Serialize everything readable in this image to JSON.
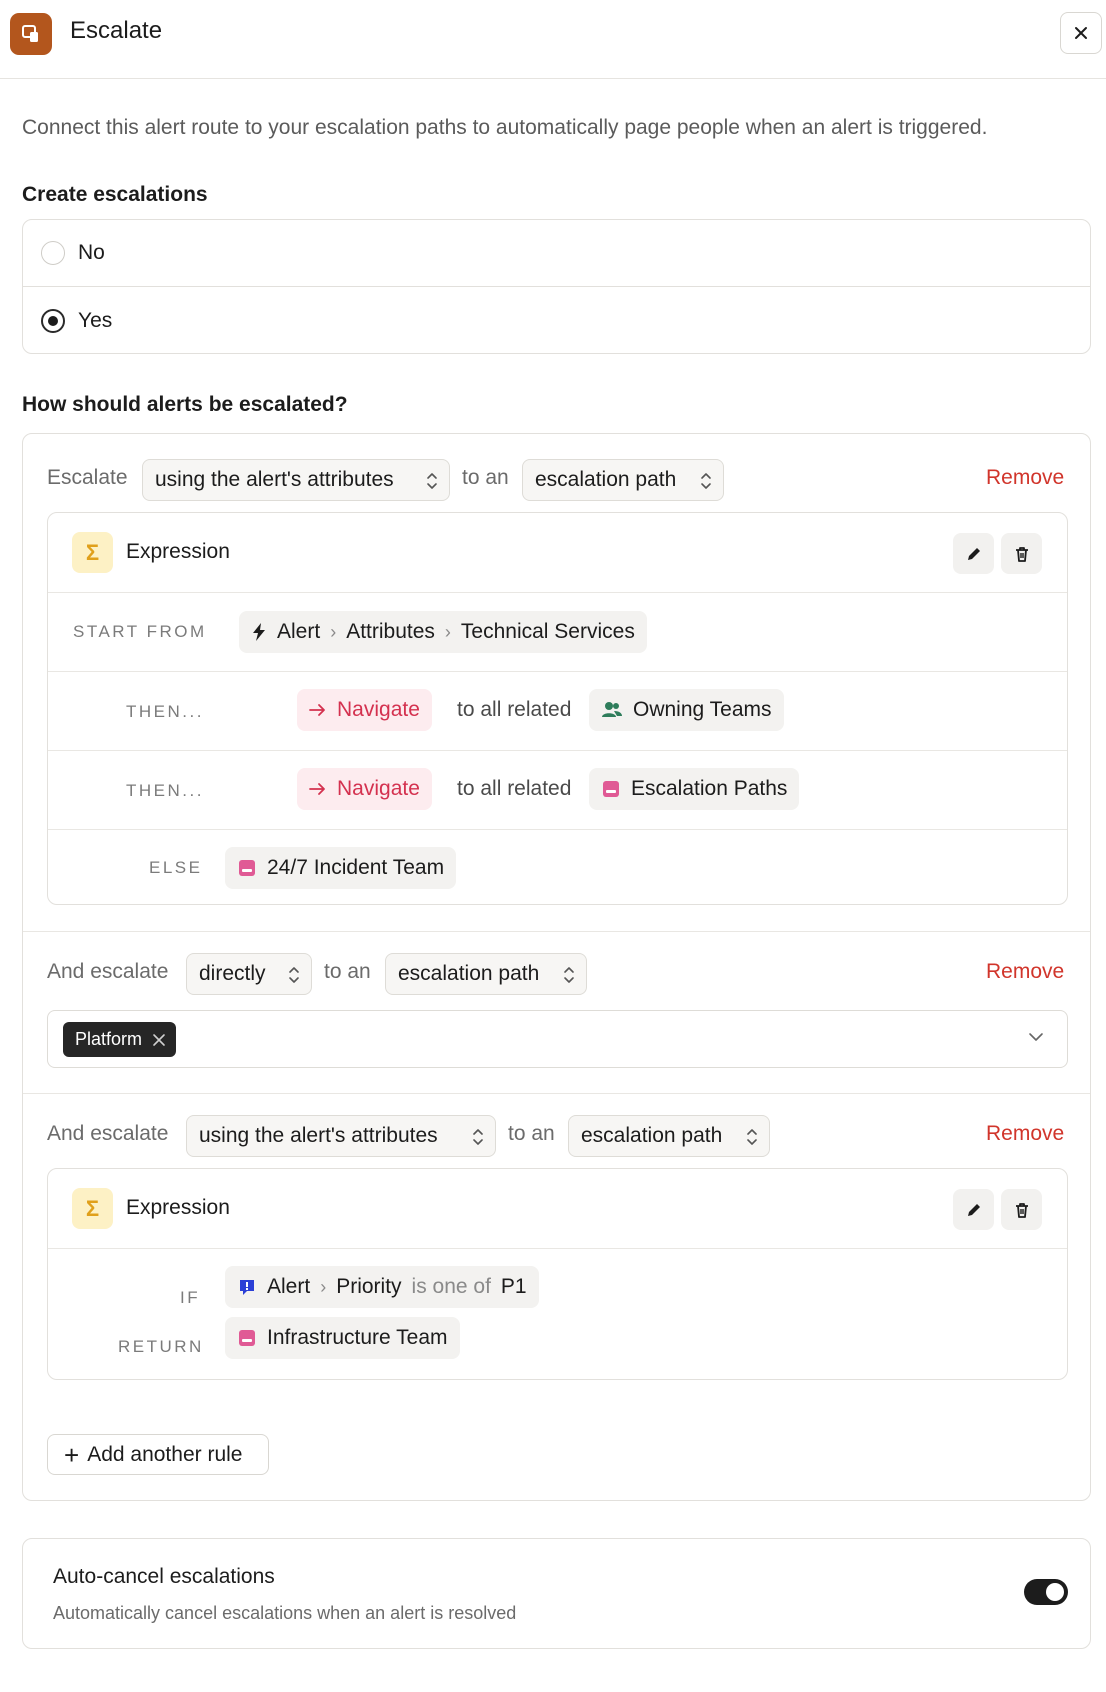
{
  "header": {
    "title": "Escalate",
    "app_icon": "escalate-app-icon",
    "close_icon": "close-icon"
  },
  "intro": "Connect this alert route to your escalation paths to automatically page people when an alert is triggered.",
  "create_escalations": {
    "label": "Create escalations",
    "options": [
      {
        "label": "No",
        "checked": false
      },
      {
        "label": "Yes",
        "checked": true
      }
    ]
  },
  "how": {
    "label": "How should alerts be escalated?"
  },
  "rules": [
    {
      "prefix": "Escalate",
      "mode": "using the alert's attributes",
      "connector": "to an",
      "target": "escalation path",
      "remove": "Remove",
      "expression": {
        "title": "Expression",
        "start_label": "START FROM",
        "start_path": [
          "Alert",
          "Attributes",
          "Technical Services"
        ],
        "steps": [
          {
            "label": "THEN...",
            "action": "Navigate",
            "middle": "to all related",
            "target": "Owning Teams"
          },
          {
            "label": "THEN...",
            "action": "Navigate",
            "middle": "to all related",
            "target": "Escalation Paths"
          }
        ],
        "else_label": "ELSE",
        "else_value": "24/7 Incident Team"
      }
    },
    {
      "prefix": "And escalate",
      "mode": "directly",
      "connector": "to an",
      "target": "escalation path",
      "remove": "Remove",
      "tags": [
        "Platform"
      ]
    },
    {
      "prefix": "And escalate",
      "mode": "using the alert's attributes",
      "connector": "to an",
      "target": "escalation path",
      "remove": "Remove",
      "expression": {
        "title": "Expression",
        "if_label": "IF",
        "if_subject": "Alert",
        "if_field": "Priority",
        "if_operator": "is one of",
        "if_value": "P1",
        "return_label": "RETURN",
        "return_value": "Infrastructure Team"
      }
    }
  ],
  "add_rule": "Add another rule",
  "auto_cancel": {
    "title": "Auto-cancel escalations",
    "description": "Automatically cancel escalations when an alert is resolved",
    "enabled": true
  },
  "colors": {
    "brand": "#b3561d",
    "remove": "#d1352b",
    "navigate": "#d4314f",
    "sigma_bg": "#fdf1c5"
  }
}
